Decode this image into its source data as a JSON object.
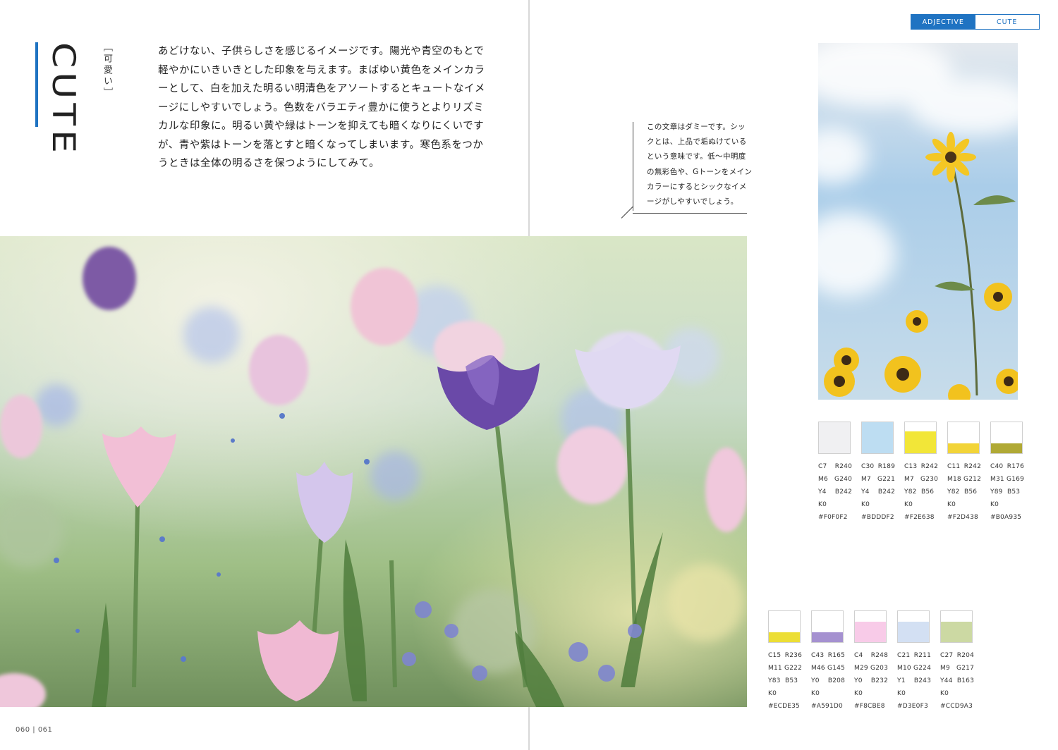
{
  "title": {
    "main": "CUTE",
    "sub": "［可愛い］"
  },
  "body_text": "あどけない、子供らしさを感じるイメージです。陽光や青空のもとで軽やかにいきいきとした印象を与えます。まばゆい黄色をメインカラーとして、白を加えた明るい明清色をアソートするとキュートなイメージにしやすいでしょう。色数をバラエティ豊かに使うとよりリズミカルな印象に。明るい黄や緑はトーンを抑えても暗くなりにくいですが、青や紫はトーンを落とすと暗くなってしまいます。寒色系をつかうときは全体の明るさを保つようにしてみて。",
  "callout": "この文章はダミーです。シックとは、上品で垢ぬけているという意味です。低～中明度の無彩色や、Gトーンをメインカラーにするとシックなイメージがしやすいでしょう。",
  "tags": [
    "ADJECTIVE",
    "CUTE"
  ],
  "folio": "060 | 061",
  "swatches_top": [
    {
      "c": "C7",
      "m": "M6",
      "y": "Y4",
      "k": "K0",
      "r": "R240",
      "g": "G240",
      "b": "B242",
      "hex": "#F0F0F2",
      "color": "#F0F0F2",
      "fill": 1.0
    },
    {
      "c": "C30",
      "m": "M7",
      "y": "Y4",
      "k": "K0",
      "r": "R189",
      "g": "G221",
      "b": "B242",
      "hex": "#BDDDF2",
      "color": "#BDDDF2",
      "fill": 1.0
    },
    {
      "c": "C13",
      "m": "M7",
      "y": "Y82",
      "k": "K0",
      "r": "R242",
      "g": "G230",
      "b": "B56",
      "hex": "#F2E638",
      "color": "#F2E638",
      "fill": 0.7
    },
    {
      "c": "C11",
      "m": "M18",
      "y": "Y82",
      "k": "K0",
      "r": "R242",
      "g": "G212",
      "b": "B56",
      "hex": "#F2D438",
      "color": "#F2D438",
      "fill": 0.32
    },
    {
      "c": "C40",
      "m": "M31",
      "y": "Y89",
      "k": "K0",
      "r": "R176",
      "g": "G169",
      "b": "B53",
      "hex": "#B0A935",
      "color": "#B0A935",
      "fill": 0.32
    }
  ],
  "swatches_bottom": [
    {
      "c": "C15",
      "m": "M11",
      "y": "Y83",
      "k": "K0",
      "r": "R236",
      "g": "G222",
      "b": "B53",
      "hex": "#ECDE35",
      "color": "#ECDE35",
      "fill": 0.32
    },
    {
      "c": "C43",
      "m": "M46",
      "y": "Y0",
      "k": "K0",
      "r": "R165",
      "g": "G145",
      "b": "B208",
      "hex": "#A591D0",
      "color": "#A591D0",
      "fill": 0.32
    },
    {
      "c": "C4",
      "m": "M29",
      "y": "Y0",
      "k": "K0",
      "r": "R248",
      "g": "G203",
      "b": "B232",
      "hex": "#F8CBE8",
      "color": "#F8CBE8",
      "fill": 0.65
    },
    {
      "c": "C21",
      "m": "M10",
      "y": "Y1",
      "k": "K0",
      "r": "R211",
      "g": "G224",
      "b": "B243",
      "hex": "#D3E0F3",
      "color": "#D3E0F3",
      "fill": 0.65
    },
    {
      "c": "C27",
      "m": "M9",
      "y": "Y44",
      "k": "K0",
      "r": "R204",
      "g": "G217",
      "b": "B163",
      "hex": "#CCD9A3",
      "color": "#CCD9A3",
      "fill": 0.65
    }
  ],
  "colors": {
    "accent": "#1F73C2"
  }
}
